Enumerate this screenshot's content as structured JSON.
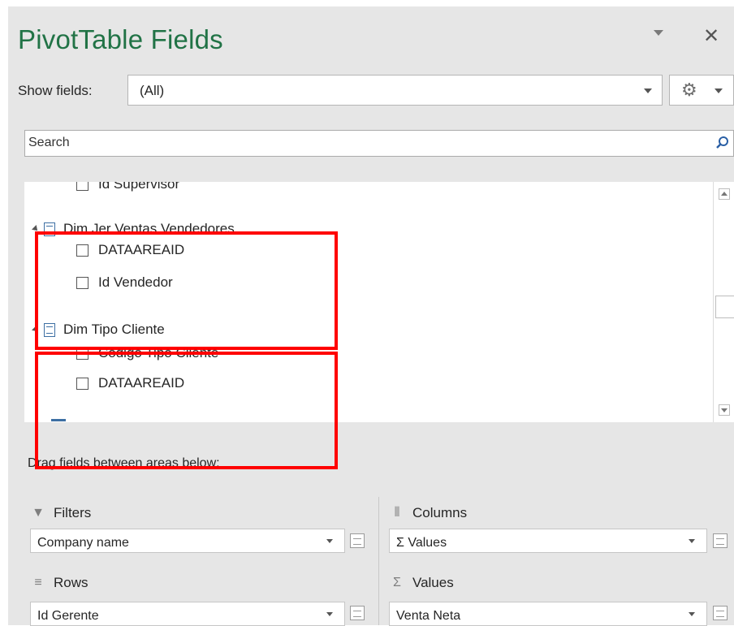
{
  "panel": {
    "title": "PivotTable Fields",
    "show_fields_label": "Show fields:",
    "show_fields_value": "(All)",
    "search_placeholder": "Search"
  },
  "field_list": {
    "items": [
      {
        "type": "field",
        "label": "Id Supervisor"
      },
      {
        "type": "table",
        "label": "Dim Jer Ventas Vendedores"
      },
      {
        "type": "field",
        "label": "DATAAREAID"
      },
      {
        "type": "field",
        "label": "Id Vendedor"
      },
      {
        "type": "table",
        "label": "Dim Tipo Cliente"
      },
      {
        "type": "field",
        "label": "Codigo Tipo Cliente"
      },
      {
        "type": "field",
        "label": "DATAAREAID"
      }
    ]
  },
  "areas": {
    "drag_label": "Drag fields between areas below:",
    "filters": {
      "label": "Filters",
      "item": "Company name"
    },
    "columns": {
      "label": "Columns",
      "item": "Σ  Values"
    },
    "rows": {
      "label": "Rows",
      "item": "Id Gerente"
    },
    "values": {
      "label": "Values",
      "item": "Venta Neta"
    }
  },
  "icons": {
    "filter": "filter-icon",
    "columns": "columns-icon",
    "rows": "rows-icon",
    "values": "sigma-icon",
    "settings": "gear-icon",
    "search": "magnifier-icon"
  },
  "colors": {
    "title": "#217346",
    "highlight": "#ff0000",
    "panel_bg": "#e6e6e6"
  }
}
